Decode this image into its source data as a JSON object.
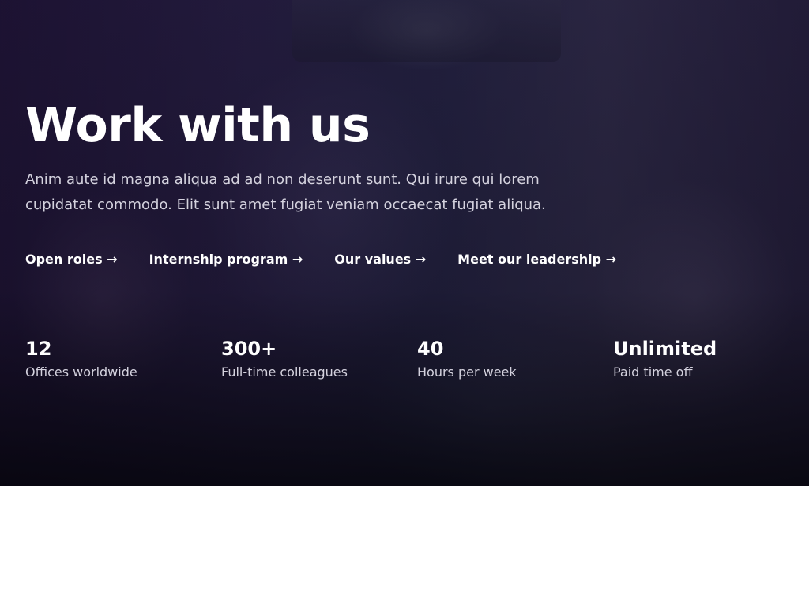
{
  "hero": {
    "title": "Work with us",
    "description": "Anim aute id magna aliqua ad ad non deserunt sunt. Qui irure qui lorem cupidatat commodo. Elit sunt amet fugiat veniam occaecat fugiat aliqua.",
    "links": [
      {
        "label": "Open roles →"
      },
      {
        "label": "Internship program →"
      },
      {
        "label": "Our values →"
      },
      {
        "label": "Meet our leadership →"
      }
    ],
    "stats": [
      {
        "value": "12",
        "label": "Offices worldwide"
      },
      {
        "value": "300+",
        "label": "Full-time colleagues"
      },
      {
        "value": "40",
        "label": "Hours per week"
      },
      {
        "value": "Unlimited",
        "label": "Paid time off"
      }
    ]
  },
  "colors": {
    "text_primary": "#ffffff",
    "text_secondary": "#d4d2de",
    "page_background": "#ffffff",
    "hero_overlay": "#1a1530"
  }
}
